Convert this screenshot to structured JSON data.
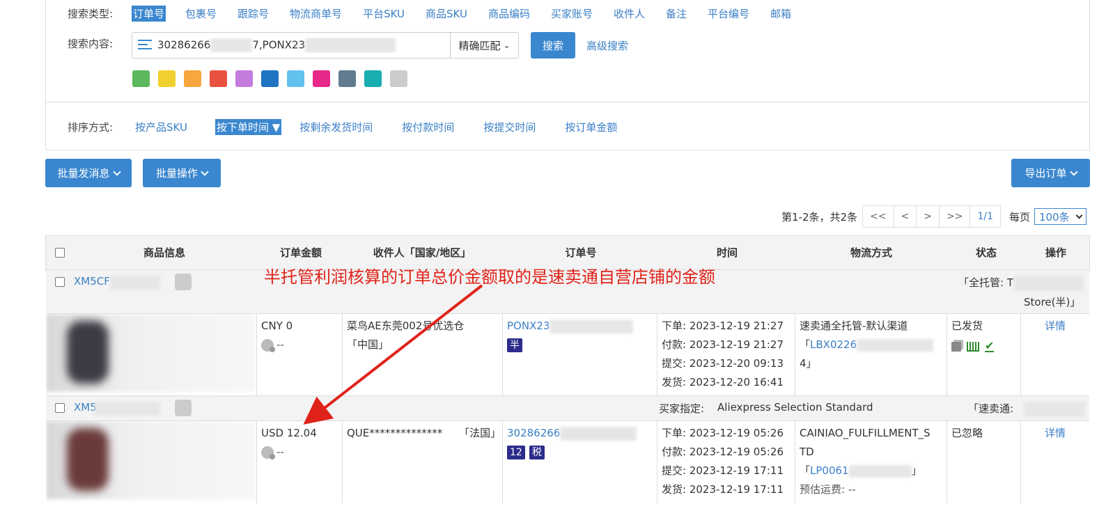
{
  "search": {
    "type_label": "搜索类型:",
    "types": [
      "订单号",
      "包裹号",
      "跟踪号",
      "物流商单号",
      "平台SKU",
      "商品SKU",
      "商品编码",
      "买家账号",
      "收件人",
      "备注",
      "平台编号",
      "邮箱"
    ],
    "content_label": "搜索内容:",
    "query_prefix": "30286266",
    "query_mid": "7,PONX23",
    "match_mode": "精确匹配",
    "search_button": "搜索",
    "advanced": "高级搜索",
    "colors": [
      "#5cb85c",
      "#f0d02e",
      "#f7a640",
      "#e9523f",
      "#c47bde",
      "#1f74c4",
      "#62c2ef",
      "#e8278b",
      "#607c8e",
      "#18aeb0",
      "#cccccc"
    ]
  },
  "sort": {
    "label": "排序方式:",
    "items": [
      "按产品SKU",
      "按下单时间",
      "按剩余发货时间",
      "按付款时间",
      "按提交时间",
      "按订单金额"
    ]
  },
  "actions": {
    "batch_message": "批量发消息",
    "batch_ops": "批量操作",
    "export": "导出订单"
  },
  "pager": {
    "info": "第1-2条，共2条",
    "first": "<<",
    "prev": "<",
    "next": ">",
    "last": ">>",
    "page": "1/1",
    "per_label": "每页",
    "per_value": "100条"
  },
  "table": {
    "headers": [
      "商品信息",
      "订单金额",
      "收件人「国家/地区」",
      "订单号",
      "时间",
      "物流方式",
      "状态",
      "操作"
    ],
    "groups": [
      {
        "order_id": "XM5CF",
        "right_text_1": "「全托管: T",
        "right_text_2": "Store(半)」"
      },
      {
        "order_id": "XM5",
        "buyer_label": "买家指定:",
        "buyer_value": "Aliexpress Selection Standard",
        "right_text_1": "「速卖通: "
      }
    ],
    "rows": [
      {
        "amount": "CNY 0",
        "profit": "--",
        "receiver": "菜鸟AE东莞002号优选仓",
        "country": "「中国」",
        "order_no": "PONX23",
        "badges": [
          "半"
        ],
        "times": [
          "下单: 2023-12-19 21:27",
          "付款: 2023-12-19 21:27",
          "提交: 2023-12-20 09:13",
          "发货: 2023-12-20 16:41"
        ],
        "logistics": "速卖通全托管-默认渠道",
        "tracking_prefix": "「",
        "tracking": "LBX0226",
        "tracking_suffix": "4」",
        "status": "已发货",
        "detail": "详情"
      },
      {
        "amount": "USD 12.04",
        "profit": "--",
        "receiver": "QUE**************",
        "country": "「法国」",
        "order_no": "30286266",
        "badges": [
          "12",
          "税"
        ],
        "times": [
          "下单: 2023-12-19 05:26",
          "付款: 2023-12-19 05:26",
          "提交: 2023-12-19 17:11",
          "发货: 2023-12-19 17:11"
        ],
        "logistics_1": "CAINIAO_FULFILLMENT_S",
        "logistics_2": "TD",
        "tracking_prefix": "「",
        "tracking": "LP0061",
        "tracking_suffix": "」",
        "freight": "预估运费: --",
        "status": "已忽略",
        "detail": "详情"
      }
    ]
  },
  "annotation": "半托管利润核算的订单总价金额取的是速卖通自营店铺的金额"
}
